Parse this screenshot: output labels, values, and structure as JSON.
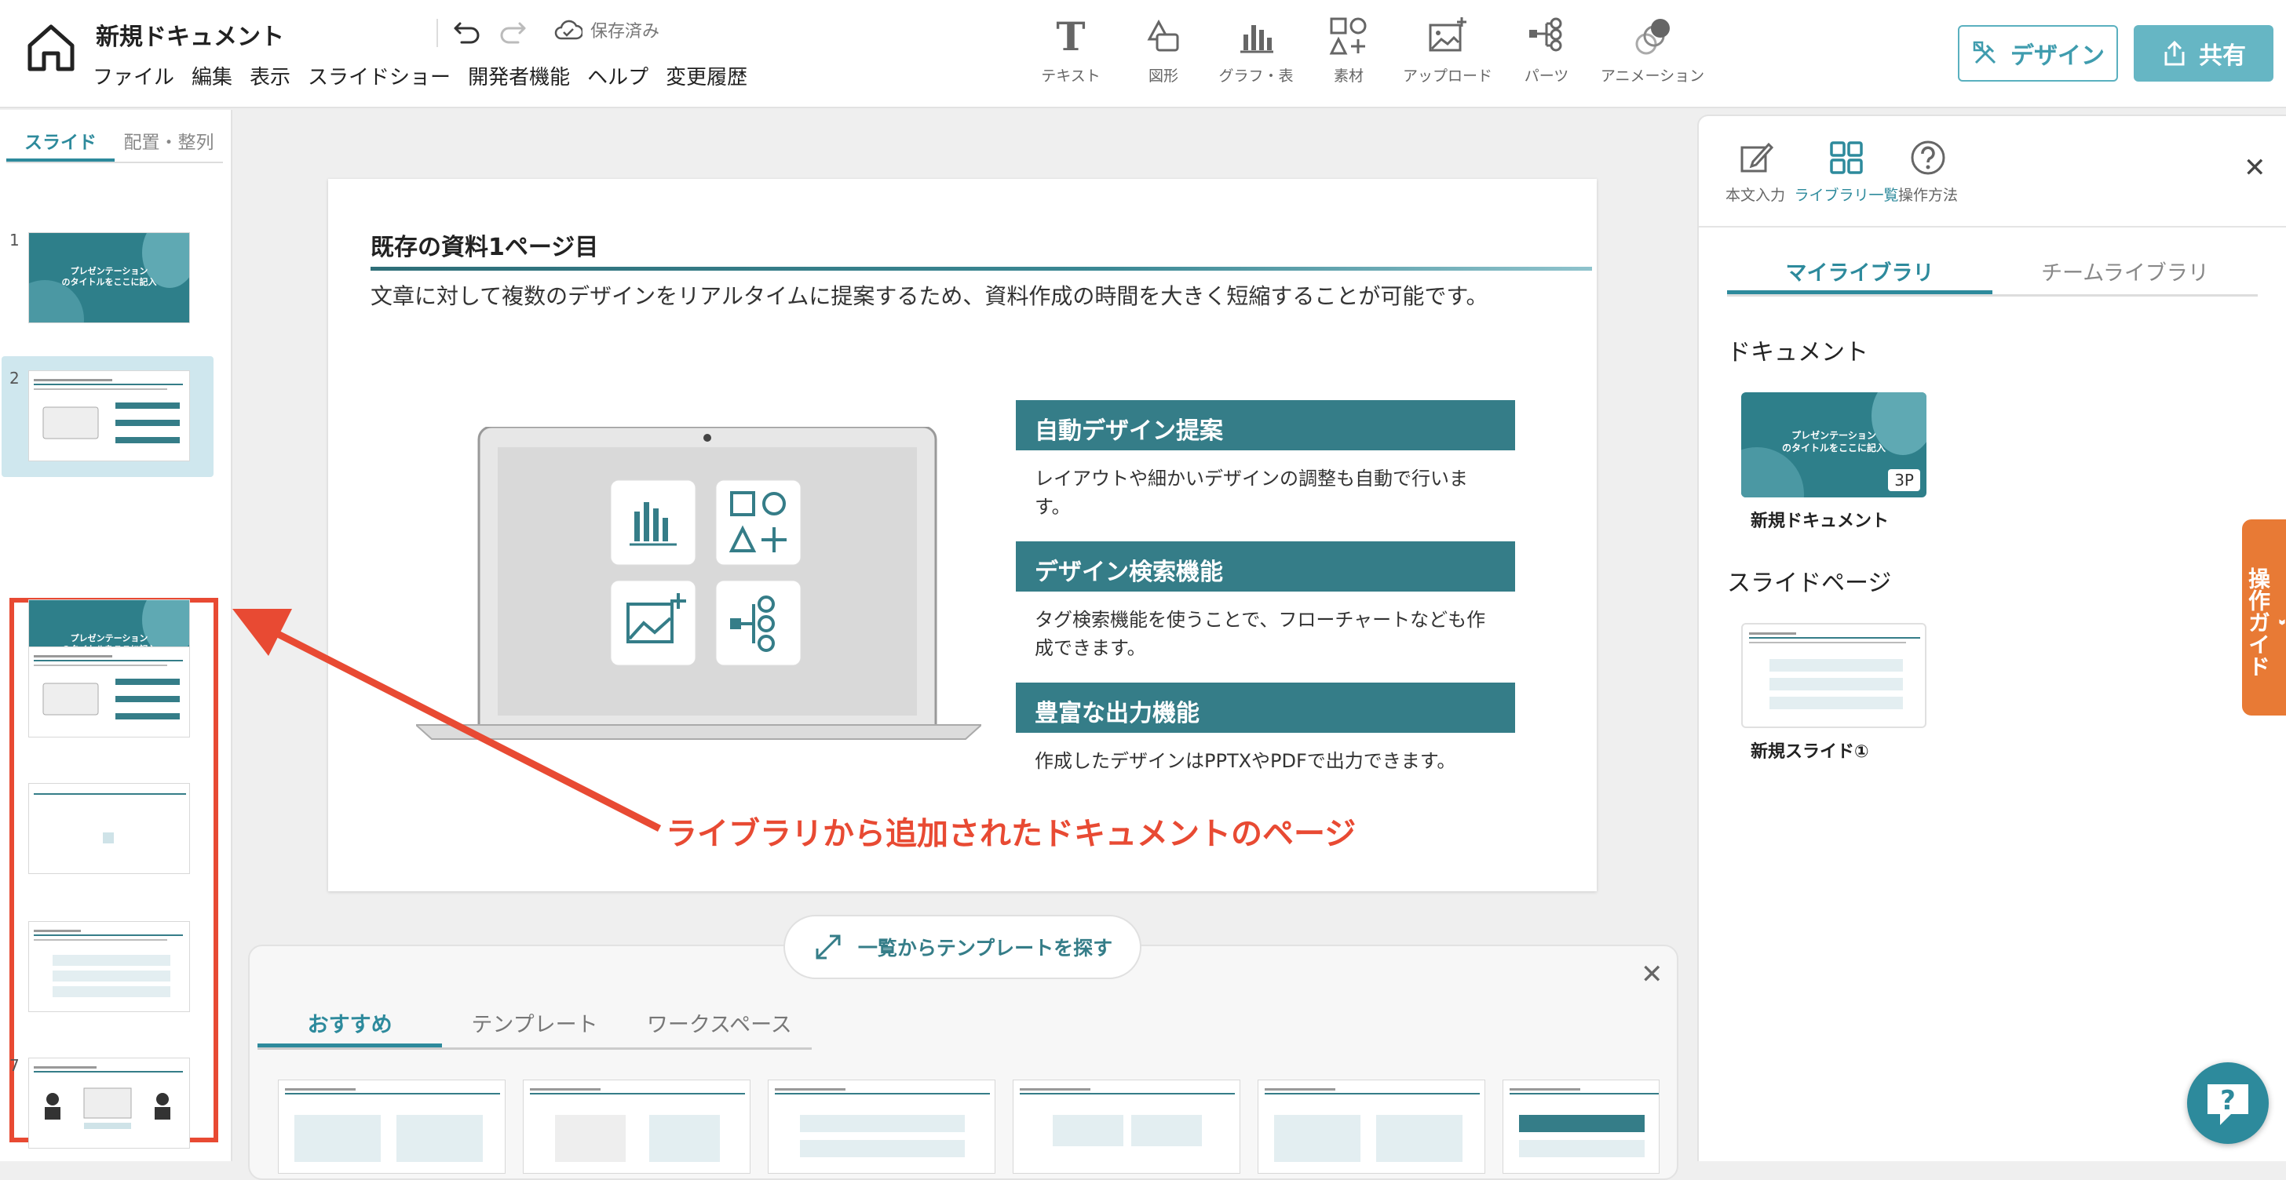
{
  "header": {
    "doc_title": "新規ドキュメント",
    "menu": [
      "ファイル",
      "編集",
      "表示",
      "スライドショー",
      "開発者機能",
      "ヘルプ",
      "変更履歴"
    ],
    "save_status": "保存済み",
    "tools": [
      {
        "label": "テキスト",
        "icon": "text-icon"
      },
      {
        "label": "図形",
        "icon": "shape-icon"
      },
      {
        "label": "グラフ・表",
        "icon": "chart-icon"
      },
      {
        "label": "素材",
        "icon": "material-icon"
      },
      {
        "label": "アップロード",
        "icon": "upload-image-icon"
      },
      {
        "label": "パーツ",
        "icon": "parts-icon"
      },
      {
        "label": "アニメーション",
        "icon": "animation-icon"
      }
    ],
    "design_button": "デザイン",
    "share_button": "共有"
  },
  "left_panel": {
    "tabs": [
      "スライド",
      "配置・整列"
    ],
    "active_tab": "スライド",
    "slide_numbers": [
      "1",
      "2",
      "7"
    ],
    "cover_title_line1": "プレゼンテーション",
    "cover_title_line2": "のタイトルをここに記入"
  },
  "slide": {
    "title": "既存の資料1ページ目",
    "body": "文章に対して複数のデザインをリアルタイムに提案するため、資料作成の時間を大きく短縮することが可能です。",
    "features": [
      {
        "heading": "自動デザイン提案",
        "text": "レイアウトや細かいデザインの調整も自動で行います。"
      },
      {
        "heading": "デザイン検索機能",
        "text": "タグ検索機能を使うことで、フローチャートなども作成できます。"
      },
      {
        "heading": "豊富な出力機能",
        "text": "作成したデザインはPPTXやPDFで出力できます。"
      }
    ]
  },
  "annotation": "ライブラリから追加されたドキュメントのページ",
  "template_panel": {
    "find_button": "一覧からテンプレートを探す",
    "tabs": [
      "おすすめ",
      "テンプレート",
      "ワークスペース"
    ],
    "active_tab": "おすすめ"
  },
  "right_panel": {
    "tabs": [
      {
        "label": "本文入力",
        "icon": "edit-icon"
      },
      {
        "label": "ライブラリ一覧",
        "icon": "grid-icon"
      },
      {
        "label": "操作方法",
        "icon": "help-circle-icon"
      }
    ],
    "active_tab": "ライブラリ一覧",
    "library_tabs": [
      "マイライブラリ",
      "チームライブラリ"
    ],
    "active_library_tab": "マイライブラリ",
    "documents_heading": "ドキュメント",
    "document_name": "新規ドキュメント",
    "document_pages": "3P",
    "slide_pages_heading": "スライドページ",
    "slide_name": "新規スライド①"
  },
  "guide_tab": "操作ガイド",
  "colors": {
    "accent": "#2d8a9c",
    "header_teal": "#357d88",
    "annotation_red": "#e84a33",
    "guide_orange": "#e87a35"
  }
}
